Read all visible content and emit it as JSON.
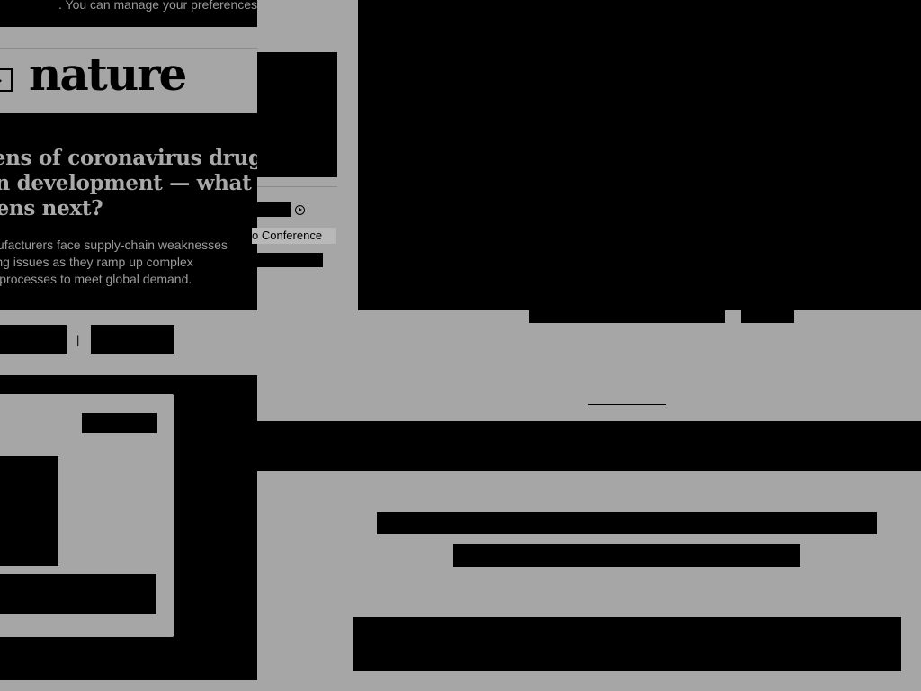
{
  "cookie_notice": {
    "text": ". You can manage your preferences"
  },
  "brand": {
    "logo": "nature"
  },
  "article": {
    "headline_lines": [
      "ozens of coronavirus drug",
      "e in development — what",
      "ppens next?"
    ],
    "standfirst_lines": [
      "g manufacturers face supply-chain weaknesses",
      "sourcing issues as they ramp up complex",
      "uction processes to meet global demand."
    ],
    "separator": "|"
  },
  "sidebar": {
    "event_label": "o Conference"
  },
  "icons": {
    "menu": "menu-toggle-icon",
    "play": "play-circle-icon"
  },
  "colors": {
    "background": "#a6a6a6",
    "redaction": "#000000"
  }
}
